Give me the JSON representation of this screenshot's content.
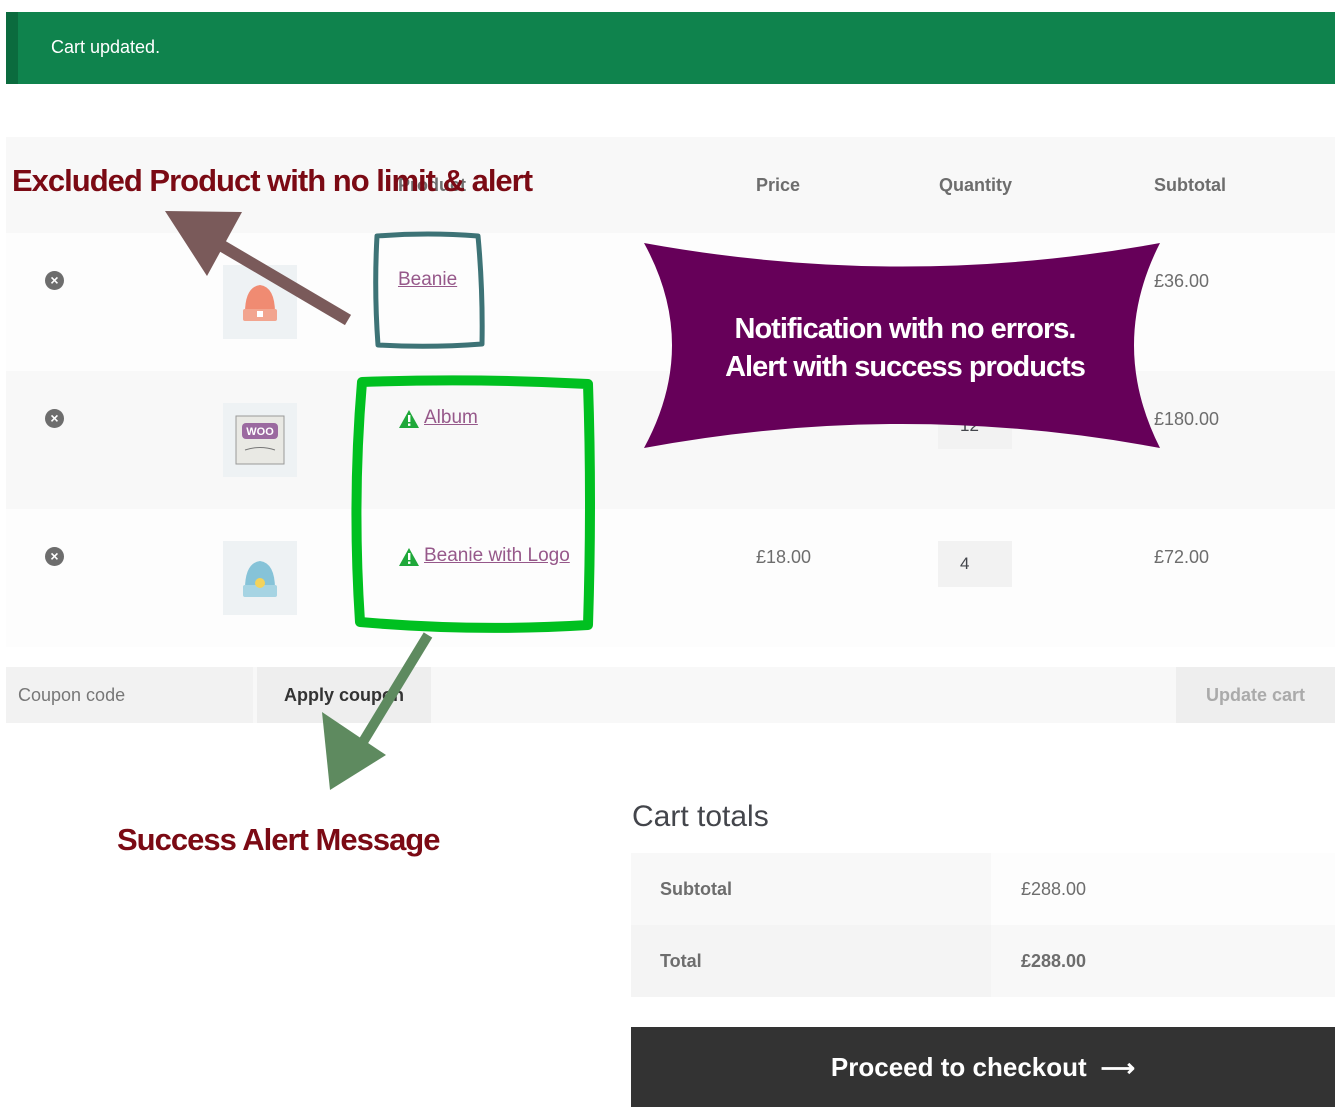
{
  "notice": {
    "message": "Cart updated."
  },
  "table": {
    "headers": {
      "product": "Product",
      "price": "Price",
      "quantity": "Quantity",
      "subtotal": "Subtotal"
    },
    "rows": [
      {
        "name": "Beanie",
        "price": "",
        "quantity": "",
        "subtotal": "£36.00",
        "remove": "×",
        "warning": false
      },
      {
        "name": "Album",
        "price": "",
        "quantity": "12",
        "subtotal": "£180.00",
        "remove": "×",
        "warning": true
      },
      {
        "name": "Beanie with Logo",
        "price": "£18.00",
        "quantity": "4",
        "subtotal": "£72.00",
        "remove": "×",
        "warning": true
      }
    ]
  },
  "actions": {
    "coupon_placeholder": "Coupon code",
    "apply_label": "Apply coupon",
    "update_label": "Update cart"
  },
  "totals": {
    "title": "Cart totals",
    "subtotal_label": "Subtotal",
    "subtotal_value": "£288.00",
    "total_label": "Total",
    "total_value": "£288.00"
  },
  "checkout": {
    "label": "Proceed to checkout",
    "arrow": "⟶"
  },
  "annotations": {
    "excluded": "Excluded Product with no limit & alert",
    "burst_line1": "Notification with no errors.",
    "burst_line2": "Alert with success products",
    "success": "Success Alert Message"
  },
  "colors": {
    "notice": "#0f834d",
    "link": "#96588a",
    "burst": "#660059",
    "annotation": "#7b0a14",
    "green_box": "#00c020",
    "teal_box": "#3d7376"
  }
}
